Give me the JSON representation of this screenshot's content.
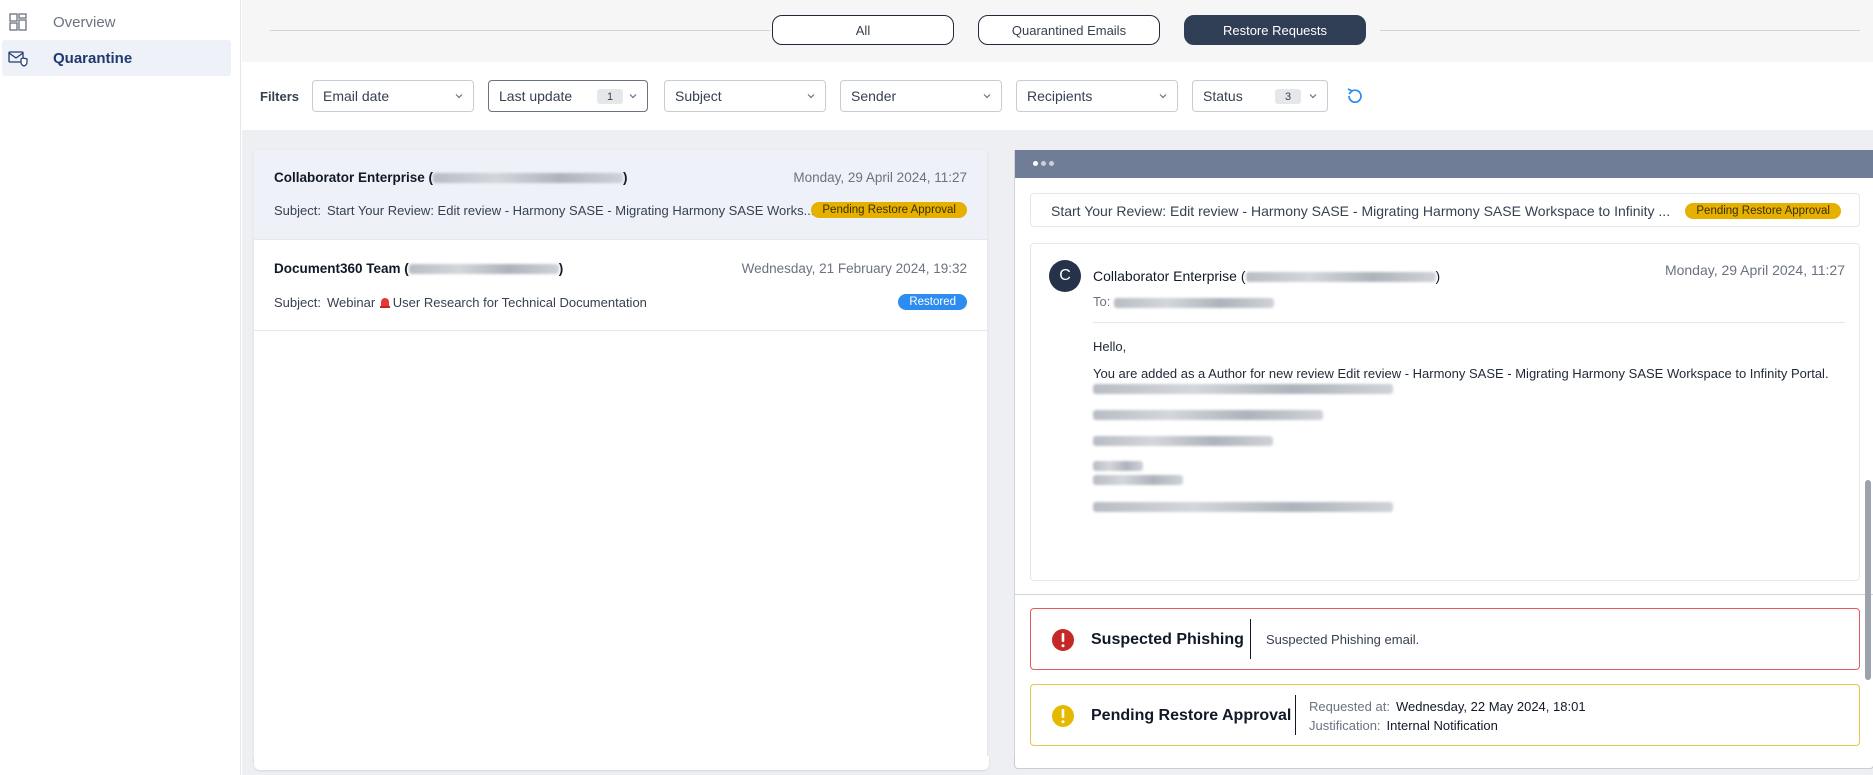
{
  "sidebar": {
    "items": [
      {
        "label": "Overview",
        "icon": "dashboard-icon",
        "active": false
      },
      {
        "label": "Quarantine",
        "icon": "mail-shield-icon",
        "active": true
      }
    ]
  },
  "tabs": [
    {
      "label": "All",
      "active": false
    },
    {
      "label": "Quarantined Emails",
      "active": false
    },
    {
      "label": "Restore Requests",
      "active": true
    }
  ],
  "filters": {
    "label": "Filters",
    "items": [
      {
        "label": "Email date",
        "count": ""
      },
      {
        "label": "Last update",
        "count": "1"
      },
      {
        "label": "Subject",
        "count": ""
      },
      {
        "label": "Sender",
        "count": ""
      },
      {
        "label": "Recipients",
        "count": ""
      },
      {
        "label": "Status",
        "count": "3"
      }
    ]
  },
  "emails": [
    {
      "sender": "Collaborator Enterprise",
      "date": "Monday, 29 April 2024, 11:27",
      "subject_key": "Subject:",
      "subject": "Start Your Review: Edit review - Harmony SASE - Migrating Harmony SASE Works...",
      "status": "Pending Restore Approval",
      "selected": true
    },
    {
      "sender": "Document360 Team",
      "date": "Wednesday, 21 February 2024, 19:32",
      "subject_key": "Subject:",
      "subject_prefix": "Webinar",
      "subject": "User Research for Technical Documentation",
      "status": "Restored",
      "selected": false
    }
  ],
  "preview": {
    "subject": "Start Your Review: Edit review - Harmony SASE - Migrating Harmony SASE Workspace to Infinity ...",
    "status": "Pending Restore Approval",
    "avatar_letter": "C",
    "from": "Collaborator Enterprise",
    "date": "Monday, 29 April 2024, 11:27",
    "to_label": "To:",
    "greeting": "Hello,",
    "line1": "You are added as a Author for new review Edit review - Harmony SASE - Migrating Harmony SASE Workspace to Infinity Portal."
  },
  "alerts": {
    "phishing": {
      "title": "Suspected Phishing",
      "desc": "Suspected Phishing email."
    },
    "pending": {
      "title": "Pending Restore Approval",
      "requested_key": "Requested at:",
      "requested_val": "Wednesday, 22 May 2024, 18:01",
      "justification_key": "Justification:",
      "justification_val": "Internal Notification"
    }
  },
  "colors": {
    "accent": "#2f3e55",
    "pending": "#e6b000",
    "restored": "#2d8cf0",
    "danger": "#d9262c",
    "warning": "#e6b000"
  }
}
